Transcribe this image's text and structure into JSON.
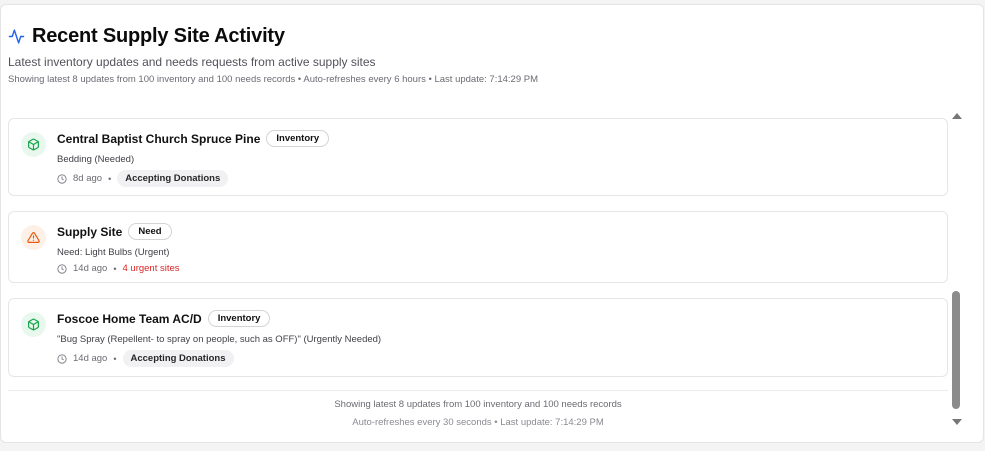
{
  "header": {
    "title": "Recent Supply Site Activity",
    "subtitle": "Latest inventory updates and needs requests from active supply sites",
    "meta": "Showing latest 8 updates from 100 inventory and 100 needs records • Auto-refreshes every 6 hours • Last update: 7:14:29 PM",
    "icon": "activity-icon",
    "accent_color": "#2563eb"
  },
  "items": [
    {
      "name": "Central Baptist Church Spruce Pine",
      "badge": "Inventory",
      "detail": "Bedding (Needed)",
      "age": "8d ago",
      "separator": "•",
      "status": "Accepting Donations",
      "icon": "package-icon",
      "icon_color": "#16a34a"
    },
    {
      "name": "Supply Site",
      "badge": "Need",
      "detail": "Need: Light Bulbs (Urgent)",
      "age": "14d ago",
      "separator": "•",
      "status": "4 urgent sites",
      "icon": "alert-triangle-icon",
      "icon_color": "#ea580c",
      "status_color": "#dc2626"
    },
    {
      "name": "Foscoe Home Team AC/D",
      "badge": "Inventory",
      "detail": "\"Bug Spray (Repellent- to spray on people, such as OFF)\" (Urgently Needed)",
      "age": "14d ago",
      "separator": "•",
      "status": "Accepting Donations",
      "icon": "package-icon",
      "icon_color": "#16a34a"
    }
  ],
  "footer": {
    "line1": "Showing latest 8 updates from 100 inventory and 100 needs records",
    "line2": "Auto-refreshes every 30 seconds • Last update: 7:14:29 PM"
  }
}
